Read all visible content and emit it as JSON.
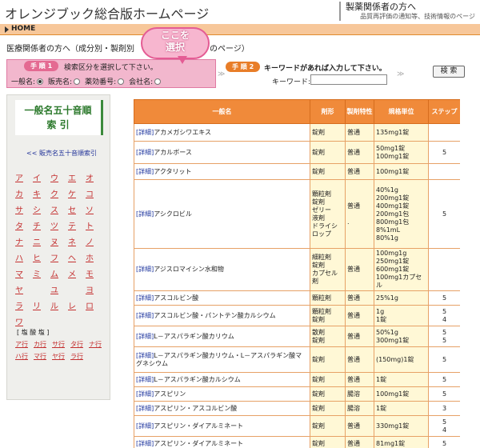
{
  "header": {
    "title": "オレンジブック総合版ホームページ",
    "right_title": "製薬関係者の方へ",
    "right_sub": "品質再評価の通知等、技術情報のページ"
  },
  "homebar": {
    "label": "HOME"
  },
  "intro": {
    "text_left": "医療関係者の方へ（成分別・製剤別",
    "text_right": "のページ）"
  },
  "callout": {
    "line1": "ここを",
    "line2": "選択"
  },
  "step1": {
    "badge": "手 順 1",
    "label": "検索区分を選択して下さい。",
    "options": [
      {
        "label": "一般名:",
        "checked": true
      },
      {
        "label": "販売名:",
        "checked": false
      },
      {
        "label": "薬効番号:",
        "checked": false
      },
      {
        "label": "会社名:",
        "checked": false
      }
    ]
  },
  "step2": {
    "badge": "手 順 2",
    "label": "キーワードがあれば入力して下さい。",
    "keyword_label": "キーワード:",
    "keyword_value": ""
  },
  "search_button": "検 索",
  "chevrons": "≫",
  "sidebar": {
    "title_line1": "一般名五十音順",
    "title_line2": "索 引",
    "back_link": "<< 販売名五十音順索引",
    "kana": [
      "ア",
      "イ",
      "ウ",
      "エ",
      "オ",
      "カ",
      "キ",
      "ク",
      "ケ",
      "コ",
      "サ",
      "シ",
      "ス",
      "セ",
      "ソ",
      "タ",
      "チ",
      "ツ",
      "テ",
      "ト",
      "ナ",
      "ニ",
      "ヌ",
      "ネ",
      "ノ",
      "ハ",
      "ヒ",
      "フ",
      "ヘ",
      "ホ",
      "マ",
      "ミ",
      "ム",
      "メ",
      "モ",
      "ヤ",
      "",
      "ユ",
      "",
      "ヨ",
      "ラ",
      "リ",
      "ル",
      "レ",
      "ロ",
      "ワ",
      "",
      "",
      "",
      ""
    ],
    "salt_title": "[ 塩 酸 塩 ]",
    "salt": [
      "ア行",
      "カ行",
      "サ行",
      "タ行",
      "ナ行",
      "ハ行",
      "マ行",
      "ヤ行",
      "ラ行"
    ]
  },
  "table": {
    "headers": [
      "一般名",
      "剤形",
      "製剤特性",
      "規格単位",
      "ステップ"
    ],
    "detail_prefix": "[詳細]",
    "rows": [
      {
        "name": "アカメガシワエキス",
        "form": "錠剤",
        "mfg": "普通",
        "unit": "135mg1錠",
        "step": "",
        "h": 22
      },
      {
        "name": "アカルボース",
        "form": "錠剤",
        "mfg": "普通",
        "unit": "50mg1錠\n100mg1錠",
        "step": "5",
        "h": 28
      },
      {
        "name": "アクタリット",
        "form": "錠剤",
        "mfg": "普通",
        "unit": "100mg1錠",
        "step": "",
        "h": 20
      },
      {
        "name": "アシクロビル",
        "form": "顆粒剤\n錠剤\nゼリー\n液剤\nドライシロップ",
        "mfg": "普通\n\n.",
        "unit": "40%1g\n200mg1錠\n400mg1錠\n200mg1包\n800mg1包\n8%1mL\n80%1g",
        "step": "5",
        "h": 86,
        "prefix": "[詳細]"
      },
      {
        "name": "アジスロマイシン水和物",
        "form": "細粒剤\n錠剤\nカプセル剤",
        "mfg": "普通",
        "unit": "100mg1g\n250mg1錠\n600mg1錠\n100mg1カプセル",
        "step": "",
        "h": 50
      },
      {
        "name": "アスコルビン酸",
        "form": "顆粒剤",
        "mfg": "普通",
        "unit": "25%1g",
        "step": "5",
        "h": 18
      },
      {
        "name": "アスコルビン酸・パントテン酸カルシウム",
        "form": "顆粒剤\n錠剤",
        "mfg": "普通",
        "unit": "1g\n1錠",
        "step": "5\n4",
        "h": 26
      },
      {
        "name": "L－アスパラギン酸カリウム",
        "form": "散剤\n錠剤",
        "mfg": "普通",
        "unit": "50%1g\n300mg1錠",
        "step": "5\n5",
        "h": 26
      },
      {
        "name": "L－アスパラギン酸カリウム・L－アスパラギン酸マグネシウム",
        "form": "錠剤",
        "mfg": "普通",
        "unit": "(150mg)1錠",
        "step": "5",
        "h": 32
      },
      {
        "name": "L－アスパラギン酸カルシウム",
        "form": "錠剤",
        "mfg": "普通",
        "unit": "1錠",
        "step": "5",
        "h": 18
      },
      {
        "name": "アスピリン",
        "form": "錠剤",
        "mfg": "腸溶",
        "unit": "100mg1錠",
        "step": "5",
        "h": 18
      },
      {
        "name": "アスピリン・アスコルビン酸",
        "form": "錠剤",
        "mfg": "腸溶",
        "unit": "1錠",
        "step": "3",
        "h": 18
      },
      {
        "name": "アスピリン・ダイアルミネート",
        "form": "錠剤",
        "mfg": "普通",
        "unit": "330mg1錠",
        "step": "5\n4",
        "h": 26
      },
      {
        "name": "アスピリン・ダイアルミネート",
        "form": "錠剤",
        "mfg": "普通",
        "unit": "81mg1錠",
        "step": "5",
        "h": 18
      }
    ]
  }
}
